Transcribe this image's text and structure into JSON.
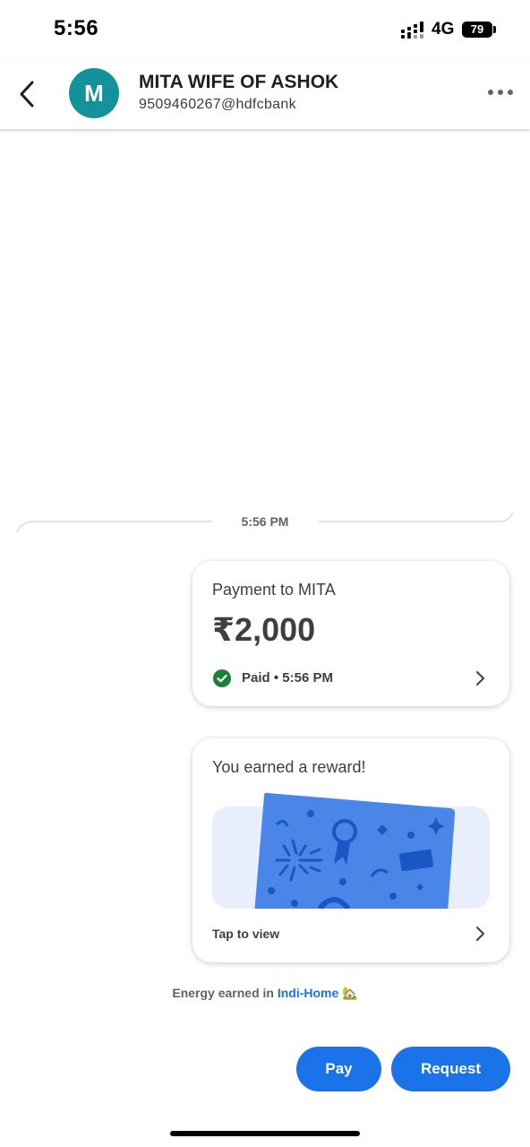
{
  "status_bar": {
    "time": "5:56",
    "network": "4G",
    "battery": "79"
  },
  "header": {
    "avatar_letter": "M",
    "name": "MITA WIFE OF ASHOK",
    "upi_id": "9509460267@hdfcbank"
  },
  "chat": {
    "divider_time": "5:56 PM",
    "payment": {
      "title": "Payment to MITA",
      "amount": "₹2,000",
      "status": "Paid • 5:56 PM"
    },
    "reward": {
      "title": "You earned a reward!",
      "cta": "Tap to view"
    },
    "energy": {
      "prefix": "Energy earned in",
      "link": "Indi-Home",
      "emoji": "🏡"
    }
  },
  "actions": {
    "pay_label": "Pay",
    "request_label": "Request"
  },
  "icons": [
    "back-arrow-icon",
    "more-options-icon",
    "check-circle-icon",
    "chevron-right-icon",
    "signal-icon",
    "battery-icon"
  ],
  "colors": {
    "accent": "#1a73e8",
    "avatar": "#13929a",
    "paid_green": "#188038",
    "reward_card": "#4a86e8"
  }
}
